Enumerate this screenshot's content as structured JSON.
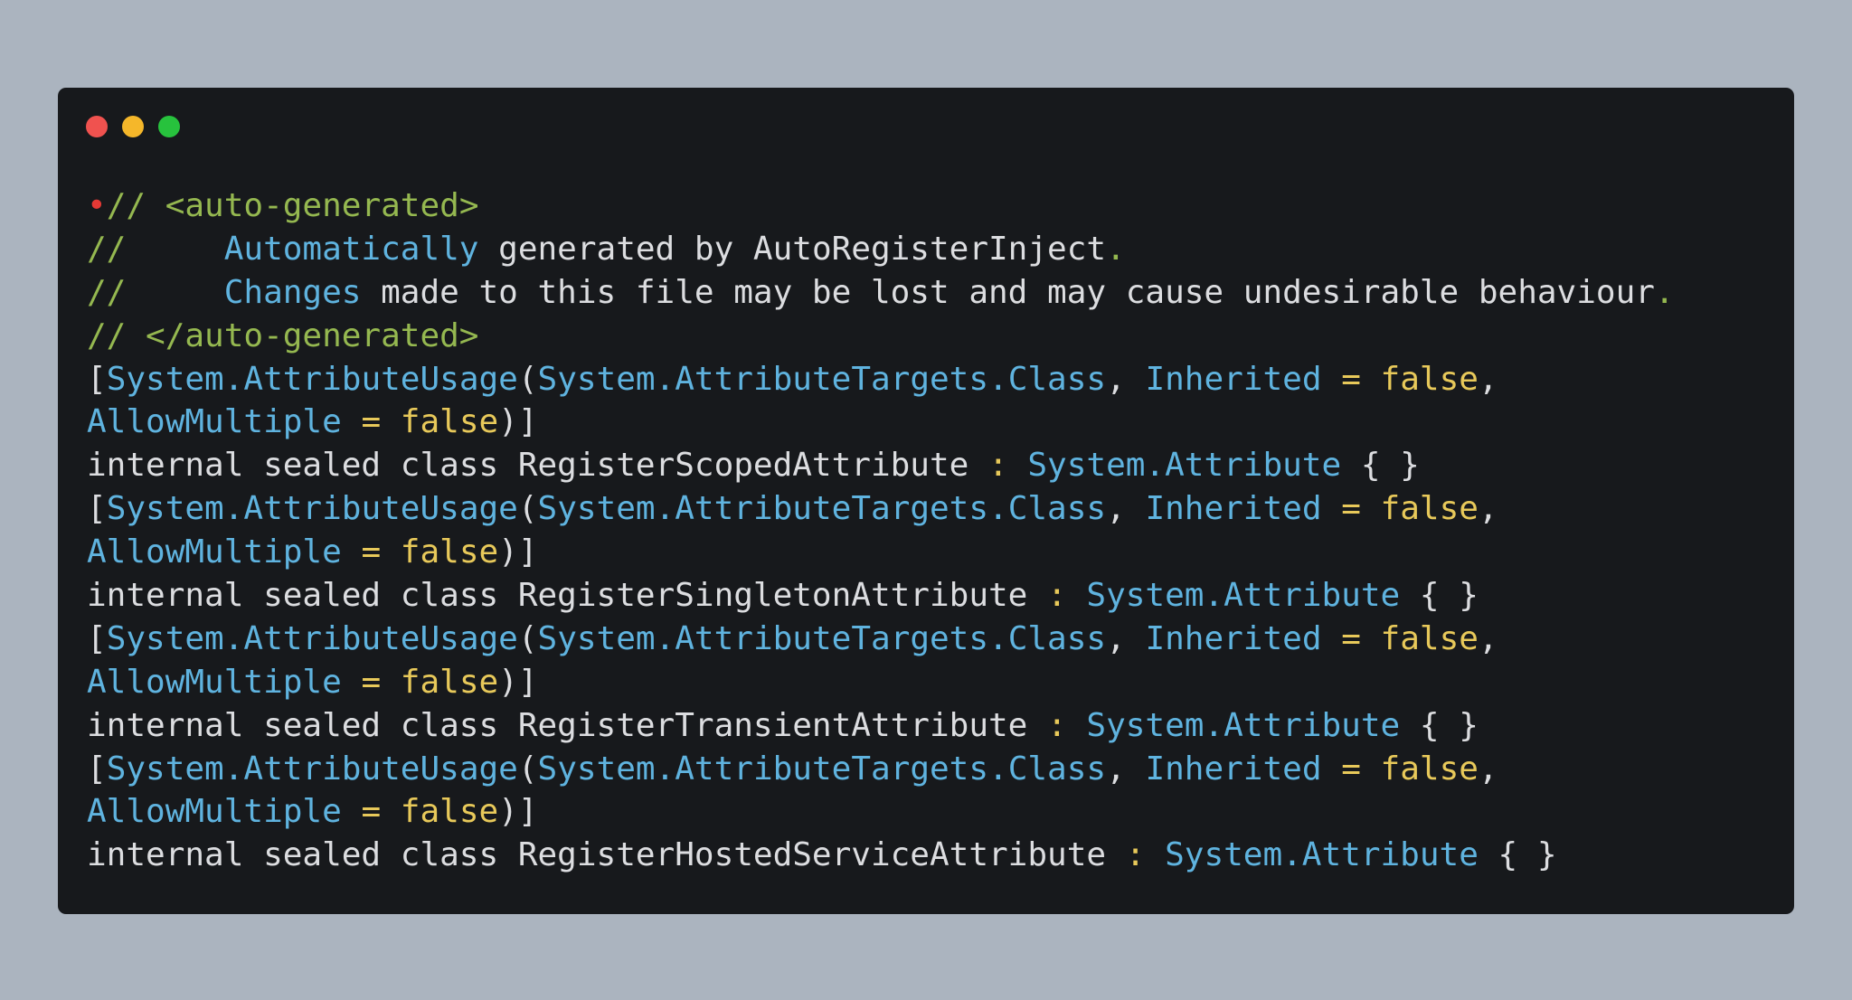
{
  "window": {
    "buttons": [
      {
        "name": "close",
        "color": "#f0524f"
      },
      {
        "name": "minimize",
        "color": "#f5b72a"
      },
      {
        "name": "maximize",
        "color": "#27c23d"
      }
    ]
  },
  "colors": {
    "background": "#abb4bf",
    "editor": "#17191c",
    "comment": "#95b850",
    "type": "#5fb3df",
    "keyword": "#dcdde0",
    "literal": "#e8c95a",
    "marker": "#e53935"
  },
  "code": {
    "lines": [
      [
        {
          "k": "marker",
          "t": "•"
        },
        {
          "k": "comment",
          "t": "// <auto-generated>"
        }
      ],
      [
        {
          "k": "comment",
          "t": "//     "
        },
        {
          "k": "type",
          "t": "Automatically"
        },
        {
          "k": "kw",
          "t": " generated by AutoRegisterInject"
        },
        {
          "k": "comment",
          "t": "."
        }
      ],
      [
        {
          "k": "comment",
          "t": "//     "
        },
        {
          "k": "type",
          "t": "Changes"
        },
        {
          "k": "kw",
          "t": " made to this file may be lost and may cause undesirable behaviour"
        },
        {
          "k": "comment",
          "t": "."
        }
      ],
      [
        {
          "k": "comment",
          "t": "// </auto-generated>"
        }
      ],
      [
        {
          "k": "punct",
          "t": "["
        },
        {
          "k": "type",
          "t": "System.AttributeUsage"
        },
        {
          "k": "punct",
          "t": "("
        },
        {
          "k": "type",
          "t": "System.AttributeTargets.Class"
        },
        {
          "k": "punct",
          "t": ", "
        },
        {
          "k": "type",
          "t": "Inherited"
        },
        {
          "k": "op",
          "t": " = "
        },
        {
          "k": "bool",
          "t": "false"
        },
        {
          "k": "punct",
          "t": ","
        }
      ],
      [
        {
          "k": "type",
          "t": "AllowMultiple"
        },
        {
          "k": "op",
          "t": " = "
        },
        {
          "k": "bool",
          "t": "false"
        },
        {
          "k": "punct",
          "t": ")]"
        }
      ],
      [
        {
          "k": "kw",
          "t": "internal sealed class RegisterScopedAttribute "
        },
        {
          "k": "op",
          "t": ":"
        },
        {
          "k": "punct",
          "t": " "
        },
        {
          "k": "type",
          "t": "System.Attribute"
        },
        {
          "k": "punct",
          "t": " { }"
        }
      ],
      [
        {
          "k": "punct",
          "t": "["
        },
        {
          "k": "type",
          "t": "System.AttributeUsage"
        },
        {
          "k": "punct",
          "t": "("
        },
        {
          "k": "type",
          "t": "System.AttributeTargets.Class"
        },
        {
          "k": "punct",
          "t": ", "
        },
        {
          "k": "type",
          "t": "Inherited"
        },
        {
          "k": "op",
          "t": " = "
        },
        {
          "k": "bool",
          "t": "false"
        },
        {
          "k": "punct",
          "t": ","
        }
      ],
      [
        {
          "k": "type",
          "t": "AllowMultiple"
        },
        {
          "k": "op",
          "t": " = "
        },
        {
          "k": "bool",
          "t": "false"
        },
        {
          "k": "punct",
          "t": ")]"
        }
      ],
      [
        {
          "k": "kw",
          "t": "internal sealed class RegisterSingletonAttribute "
        },
        {
          "k": "op",
          "t": ":"
        },
        {
          "k": "punct",
          "t": " "
        },
        {
          "k": "type",
          "t": "System.Attribute"
        },
        {
          "k": "punct",
          "t": " { }"
        }
      ],
      [
        {
          "k": "punct",
          "t": "["
        },
        {
          "k": "type",
          "t": "System.AttributeUsage"
        },
        {
          "k": "punct",
          "t": "("
        },
        {
          "k": "type",
          "t": "System.AttributeTargets.Class"
        },
        {
          "k": "punct",
          "t": ", "
        },
        {
          "k": "type",
          "t": "Inherited"
        },
        {
          "k": "op",
          "t": " = "
        },
        {
          "k": "bool",
          "t": "false"
        },
        {
          "k": "punct",
          "t": ","
        }
      ],
      [
        {
          "k": "type",
          "t": "AllowMultiple"
        },
        {
          "k": "op",
          "t": " = "
        },
        {
          "k": "bool",
          "t": "false"
        },
        {
          "k": "punct",
          "t": ")]"
        }
      ],
      [
        {
          "k": "kw",
          "t": "internal sealed class RegisterTransientAttribute "
        },
        {
          "k": "op",
          "t": ":"
        },
        {
          "k": "punct",
          "t": " "
        },
        {
          "k": "type",
          "t": "System.Attribute"
        },
        {
          "k": "punct",
          "t": " { }"
        }
      ],
      [
        {
          "k": "punct",
          "t": "["
        },
        {
          "k": "type",
          "t": "System.AttributeUsage"
        },
        {
          "k": "punct",
          "t": "("
        },
        {
          "k": "type",
          "t": "System.AttributeTargets.Class"
        },
        {
          "k": "punct",
          "t": ", "
        },
        {
          "k": "type",
          "t": "Inherited"
        },
        {
          "k": "op",
          "t": " = "
        },
        {
          "k": "bool",
          "t": "false"
        },
        {
          "k": "punct",
          "t": ","
        }
      ],
      [
        {
          "k": "type",
          "t": "AllowMultiple"
        },
        {
          "k": "op",
          "t": " = "
        },
        {
          "k": "bool",
          "t": "false"
        },
        {
          "k": "punct",
          "t": ")]"
        }
      ],
      [
        {
          "k": "kw",
          "t": "internal sealed class RegisterHostedServiceAttribute "
        },
        {
          "k": "op",
          "t": ":"
        },
        {
          "k": "punct",
          "t": " "
        },
        {
          "k": "type",
          "t": "System.Attribute"
        },
        {
          "k": "punct",
          "t": " { }"
        }
      ]
    ]
  }
}
